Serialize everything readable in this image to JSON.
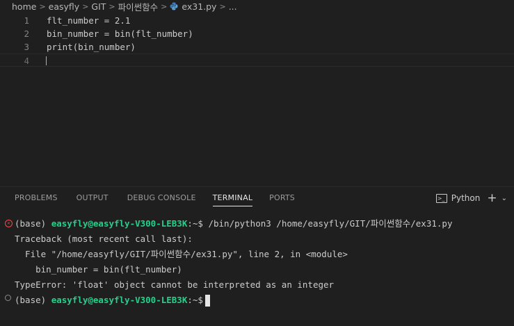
{
  "breadcrumb": {
    "items": [
      "home",
      "easyfly",
      "GIT",
      "파이썬함수"
    ],
    "file": "ex31.py",
    "ellipsis": "..."
  },
  "editor": {
    "lines": [
      {
        "num": "1",
        "text": "flt_number = 2.1"
      },
      {
        "num": "2",
        "text": "bin_number = bin(flt_number)"
      },
      {
        "num": "3",
        "text": "print(bin_number)"
      },
      {
        "num": "4",
        "text": ""
      }
    ]
  },
  "panel": {
    "tabs": [
      "PROBLEMS",
      "OUTPUT",
      "DEBUG CONSOLE",
      "TERMINAL",
      "PORTS"
    ],
    "active_tab": "TERMINAL",
    "shell_label": "Python",
    "plus": "+",
    "chevron": "⌄"
  },
  "terminal": {
    "env": "(base)",
    "user_host": "easyfly@easyfly-V300-LEB3K",
    "prompt_suffix": ":~$",
    "command": " /bin/python3 /home/easyfly/GIT/파이썬함수/ex31.py",
    "traceback_header": "Traceback (most recent call last):",
    "file_line": "  File \"/home/easyfly/GIT/파이썬함수/ex31.py\", line 2, in <module>",
    "code_line": "    bin_number = bin(flt_number)",
    "error_line": "TypeError: 'float' object cannot be interpreted as an integer"
  },
  "colors": {
    "accent_green": "#23d18b",
    "error_red": "#f14c4c"
  }
}
